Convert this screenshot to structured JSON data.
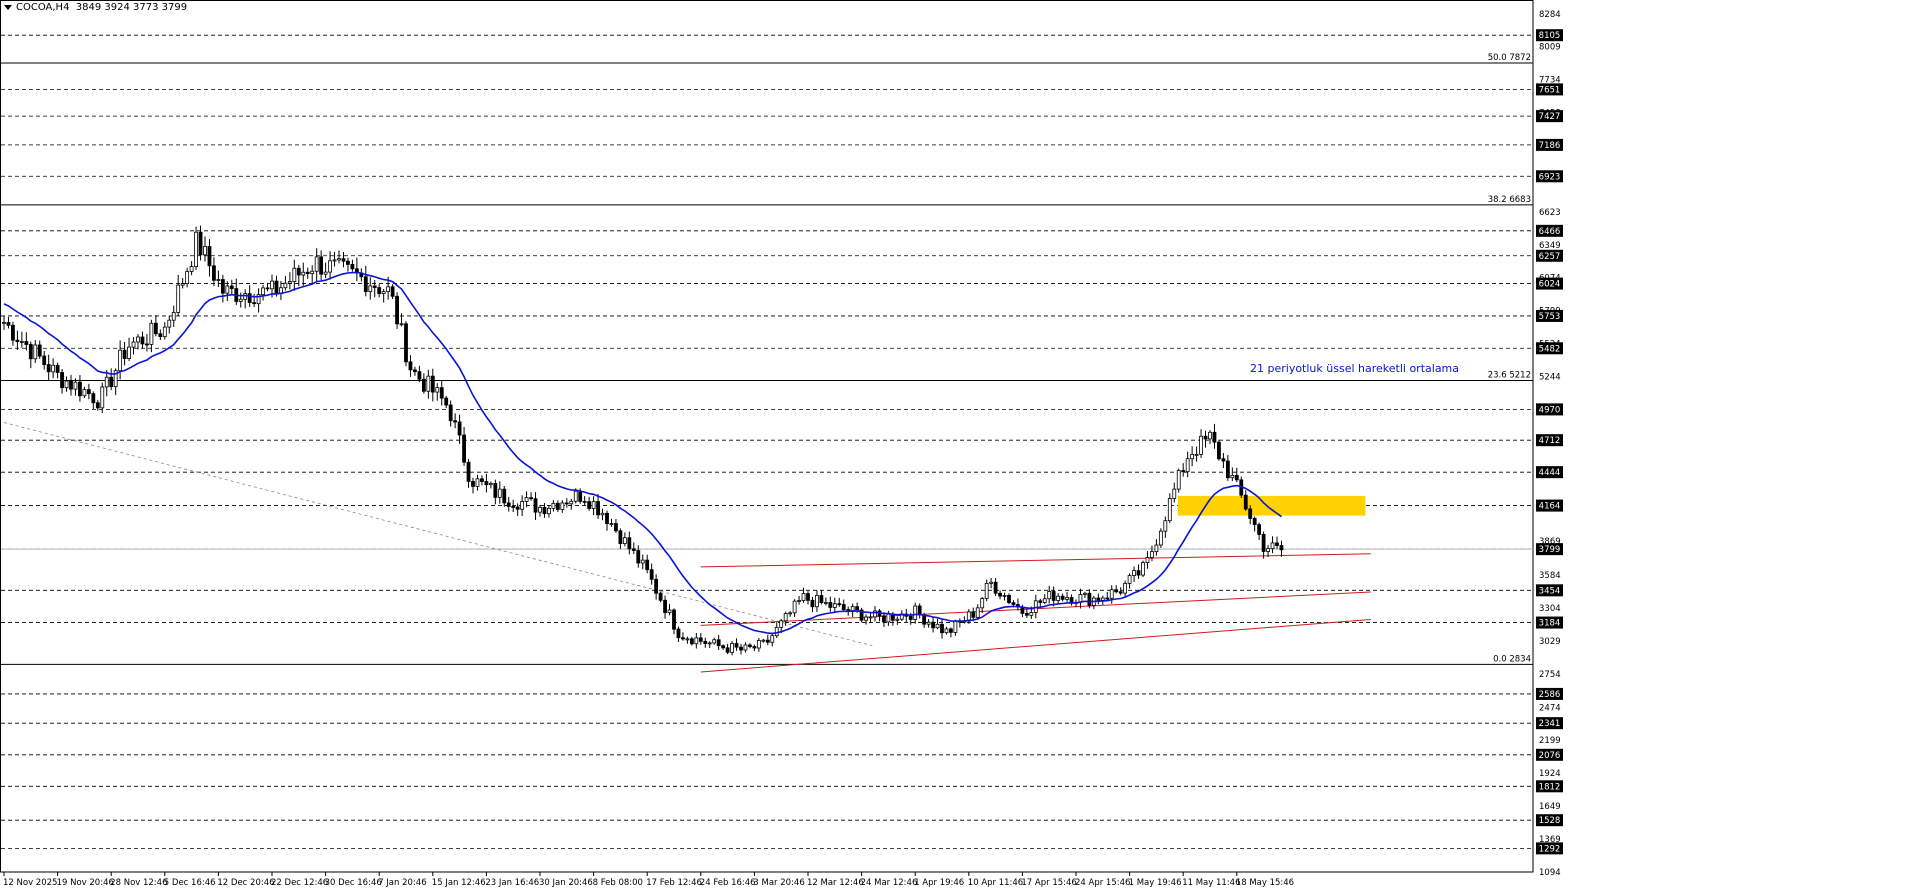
{
  "header": {
    "symbol": "COCOA,H4",
    "ohlc": "3849 3924 3773 3799"
  },
  "annotation": "21 periyotluk üssel hareketli ortalama",
  "chart_data": {
    "type": "candlestick",
    "timeframe": "H4",
    "ylim": [
      1094,
      8400
    ],
    "x_labels": [
      "12 Nov 2025",
      "19 Nov 20:46",
      "28 Nov 12:46",
      "5 Dec 16:46",
      "12 Dec 20:46",
      "22 Dec 12:46",
      "30 Dec 16:46",
      "7 Jan 20:46",
      "15 Jan 12:46",
      "23 Jan 16:46",
      "30 Jan 20:46",
      "8 Feb 08:00",
      "17 Feb 12:46",
      "24 Feb 16:46",
      "3 Mar 20:46",
      "12 Mar 12:46",
      "24 Mar 12:46",
      "1 Apr 19:46",
      "10 Apr 11:46",
      "17 Apr 15:46",
      "24 Apr 15:46",
      "1 May 19:46",
      "11 May 11:46",
      "18 May 15:46"
    ],
    "y_ticks": [
      8284,
      8009,
      7734,
      7458,
      7183,
      6908,
      6623,
      6349,
      6074,
      5799,
      5524,
      5244,
      4974,
      4699,
      4424,
      4149,
      3869,
      3584,
      3304,
      3029,
      2754,
      2474,
      2199,
      1924,
      1649,
      1369,
      1094
    ],
    "boxed_levels": [
      8105,
      7651,
      7427,
      7186,
      6923,
      6466,
      6257,
      6024,
      5753,
      5482,
      4970,
      4712,
      4444,
      4164,
      3799,
      3454,
      3184,
      2586,
      2341,
      2076,
      1812,
      1528,
      1292
    ],
    "fib_levels": [
      {
        "label": "50.0",
        "value": 7872
      },
      {
        "label": "38.2",
        "value": 6683
      },
      {
        "label": "23.6",
        "value": 5212
      },
      {
        "label": "0.0",
        "value": 2834
      }
    ],
    "current_price": 3799,
    "ema_period": 21,
    "ema_color": "#0a14d2",
    "zone": {
      "low": 4080,
      "high": 4245,
      "color": "#ffd200"
    },
    "channel": {
      "color": "#d01c1c",
      "upper": [
        [
          13,
          3650
        ],
        [
          25.5,
          3760
        ]
      ],
      "lower": [
        [
          13,
          2770
        ],
        [
          25.5,
          3210
        ]
      ],
      "middle": [
        [
          13,
          3160
        ],
        [
          25.5,
          3440
        ]
      ]
    },
    "trendline": {
      "color": "#888888",
      "points": [
        [
          0,
          4860
        ],
        [
          16.2,
          2990
        ]
      ]
    },
    "key_points": [
      {
        "x": 0,
        "y": 5700
      },
      {
        "x": 1,
        "y": 5250
      },
      {
        "x": 1.8,
        "y": 5050
      },
      {
        "x": 2.3,
        "y": 5500
      },
      {
        "x": 3,
        "y": 5650
      },
      {
        "x": 3.6,
        "y": 6380
      },
      {
        "x": 4.1,
        "y": 5950
      },
      {
        "x": 5,
        "y": 5950
      },
      {
        "x": 5.8,
        "y": 6200
      },
      {
        "x": 6.8,
        "y": 6050
      },
      {
        "x": 7.2,
        "y": 5950
      },
      {
        "x": 7.6,
        "y": 5300
      },
      {
        "x": 8.3,
        "y": 4990
      },
      {
        "x": 8.7,
        "y": 4390
      },
      {
        "x": 9.3,
        "y": 4240
      },
      {
        "x": 10,
        "y": 4150
      },
      {
        "x": 10.8,
        "y": 4260
      },
      {
        "x": 11.2,
        "y": 4100
      },
      {
        "x": 12,
        "y": 3600
      },
      {
        "x": 12.6,
        "y": 3090
      },
      {
        "x": 13.3,
        "y": 2990
      },
      {
        "x": 13.8,
        "y": 2950
      },
      {
        "x": 14.2,
        "y": 3000
      },
      {
        "x": 14.9,
        "y": 3390
      },
      {
        "x": 15.6,
        "y": 3300
      },
      {
        "x": 16.3,
        "y": 3220
      },
      {
        "x": 17,
        "y": 3270
      },
      {
        "x": 17.6,
        "y": 3100
      },
      {
        "x": 18.1,
        "y": 3270
      },
      {
        "x": 18.4,
        "y": 3520
      },
      {
        "x": 19,
        "y": 3280
      },
      {
        "x": 19.6,
        "y": 3420
      },
      {
        "x": 20.3,
        "y": 3380
      },
      {
        "x": 20.8,
        "y": 3450
      },
      {
        "x": 21.3,
        "y": 3650
      },
      {
        "x": 21.8,
        "y": 4250
      },
      {
        "x": 22.1,
        "y": 4600
      },
      {
        "x": 22.5,
        "y": 4730
      },
      {
        "x": 22.9,
        "y": 4400
      },
      {
        "x": 23.2,
        "y": 4130
      },
      {
        "x": 23.5,
        "y": 3830
      },
      {
        "x": 23.8,
        "y": 3790
      }
    ]
  }
}
